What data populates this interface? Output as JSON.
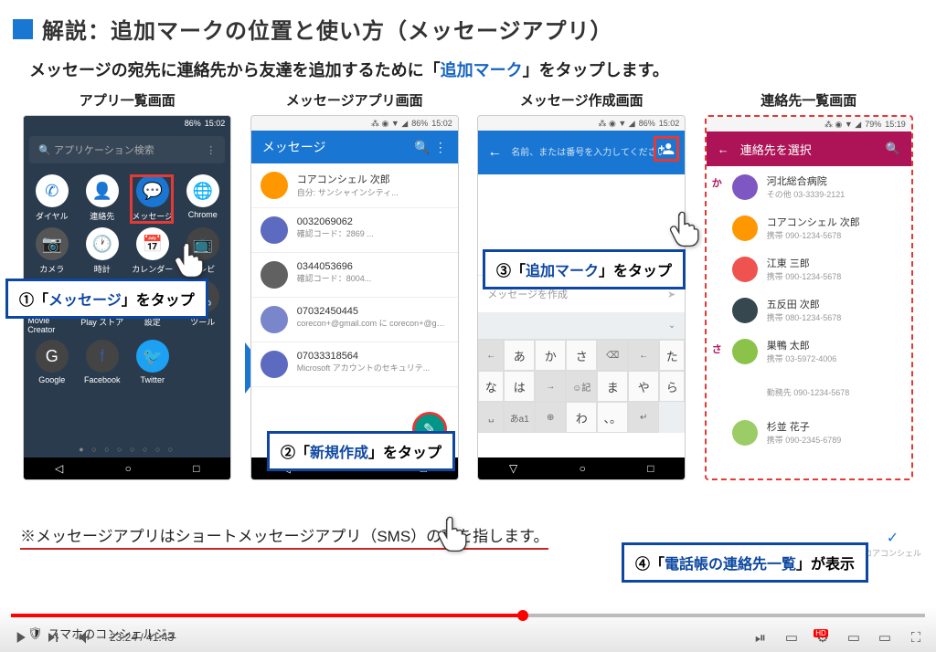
{
  "title": "解説：追加マークの位置と使い方（メッセージアプリ）",
  "subtitle_pre": "メッセージの宛先に連絡先から友達を追加するために「",
  "subtitle_hl": "追加マーク",
  "subtitle_post": "」をタップします。",
  "columns": [
    "アプリ一覧画面",
    "メッセージアプリ画面",
    "メッセージ作成画面",
    "連絡先一覧画面"
  ],
  "phone1": {
    "search_placeholder": "アプリケーション検索",
    "status_time": "15:02",
    "status_batt": "86%",
    "apps_r1": [
      "ダイヤル",
      "連絡先",
      "メッセージ",
      "Chrome"
    ],
    "apps_r2": [
      "カメラ",
      "時計",
      "カレンダー",
      "テレビ"
    ],
    "apps_r3": [
      "Movie Creator",
      "Play ストア",
      "設定",
      "ツール"
    ],
    "apps_r4": [
      "Google",
      "Facebook",
      "Twitter",
      ""
    ]
  },
  "phone2": {
    "header": "メッセージ",
    "status_time": "15:02",
    "status_batt": "86%",
    "rows": [
      {
        "name": "コアコンシェル 次郎",
        "sub": "自分: サンシャインシティ...",
        "color": "#ff9800"
      },
      {
        "name": "0032069062",
        "sub": "確認コード：2869 ...",
        "color": "#5c6bc0"
      },
      {
        "name": "0344053696",
        "sub": "確認コード：8004...",
        "color": "#616161"
      },
      {
        "name": "07032450445",
        "sub": "corecon+@gmail.com に corecon+@gm...",
        "color": "#7986cb"
      },
      {
        "name": "07033318564",
        "sub": "Microsoft アカウントのセキュリテ...",
        "color": "#5c6bc0"
      }
    ]
  },
  "phone3": {
    "status_time": "15:02",
    "status_batt": "86%",
    "input_placeholder": "名前、または番号を入力してください",
    "compose_placeholder": "メッセージを作成",
    "kbd_rows": [
      [
        "",
        "あ",
        "か",
        "さ",
        ""
      ],
      [
        "",
        "た",
        "な",
        "は",
        ""
      ],
      [
        "",
        "ま",
        "や",
        "ら",
        ""
      ],
      [
        "",
        "",
        "わ",
        "、。",
        ""
      ]
    ]
  },
  "phone4": {
    "header": "連絡先を選択",
    "status_time": "15:19",
    "status_batt": "79%",
    "index1": "か",
    "index2": "さ",
    "contacts": [
      {
        "name": "河北総合病院",
        "sub": "その他 03-3339-2121",
        "color": "#7e57c2"
      },
      {
        "name": "コアコンシェル 次郎",
        "sub": "携帯 090-1234-5678",
        "color": "#ff9800"
      },
      {
        "name": "江東 三郎",
        "sub": "携帯 090-1234-5678",
        "color": "#ef5350"
      },
      {
        "name": "五反田 次郎",
        "sub": "携帯 080-1234-5678",
        "color": "#37474f"
      },
      {
        "name": "巣鴨 太郎",
        "sub": "携帯 03-5972-4006",
        "color": "#8bc34a"
      },
      {
        "name": "",
        "sub": "勤務先 090-1234-5678",
        "color": "transparent"
      },
      {
        "name": "杉並 花子",
        "sub": "携帯 090-2345-6789",
        "color": "#9ccc65"
      }
    ]
  },
  "callouts": {
    "c1_num": "①",
    "c1_pre": "「",
    "c1_hl": "メッセージ",
    "c1_post": "」をタップ",
    "c2_num": "②",
    "c2_pre": "「",
    "c2_hl": "新規作成",
    "c2_post": "」をタップ",
    "c3_num": "③",
    "c3_pre": "「",
    "c3_hl": "追加マーク",
    "c3_post": "」をタップ",
    "c4_num": "④",
    "c4_pre": "「",
    "c4_hl": "電話帳の連絡先一覧",
    "c4_post": "」が表示"
  },
  "footnote": "※メッセージアプリはショートメッセージアプリ（SMS）の事を指します。",
  "brand": "コアコンシェル",
  "channel": "スマホのコンシェルジュ",
  "video": {
    "current": "23:24",
    "duration": "41:43"
  }
}
